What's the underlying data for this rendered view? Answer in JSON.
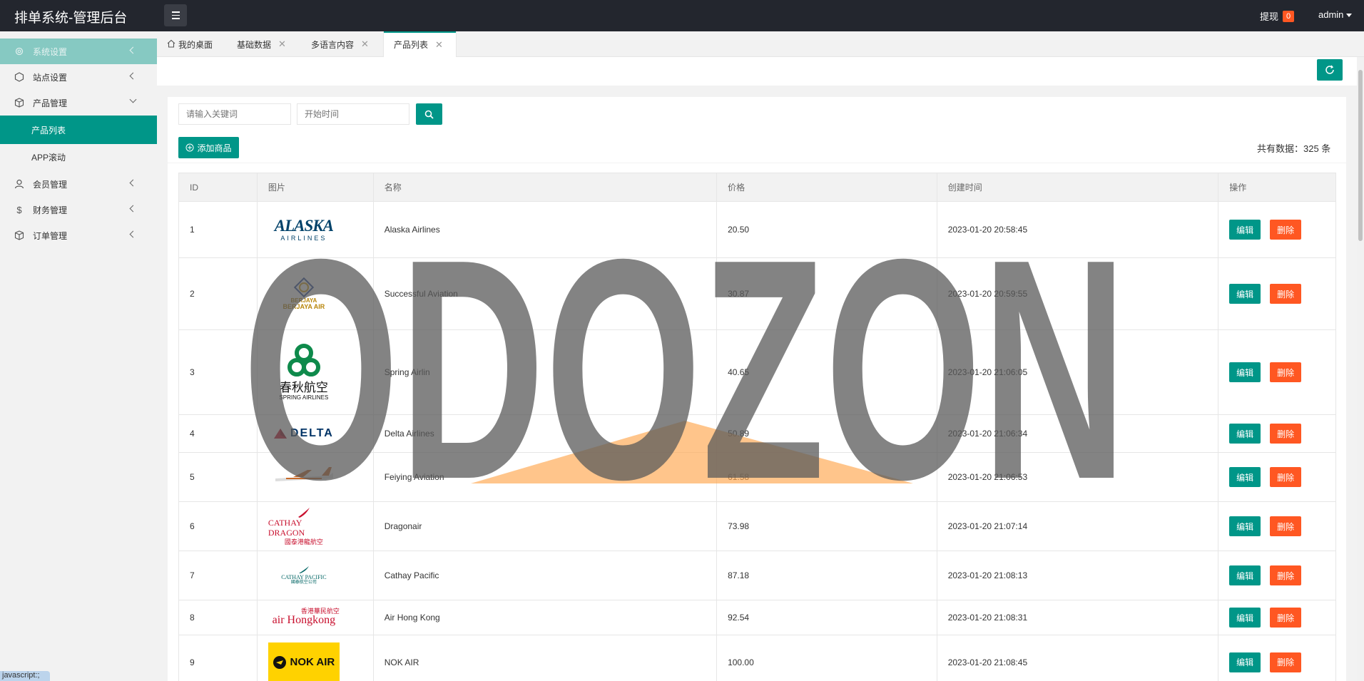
{
  "app": {
    "brand": "排单系统-管理后台",
    "withdraw_label": "提现",
    "withdraw_count": "0",
    "user": "admin"
  },
  "sidebar": {
    "items": [
      {
        "label": "系统设置",
        "icon": "gear-icon"
      },
      {
        "label": "站点设置",
        "icon": "cube-icon"
      },
      {
        "label": "产品管理",
        "icon": "box-icon"
      },
      {
        "label": "产品列表"
      },
      {
        "label": "APP滚动"
      },
      {
        "label": "会员管理",
        "icon": "user-icon"
      },
      {
        "label": "财务管理",
        "icon": "dollar-icon"
      },
      {
        "label": "订单管理",
        "icon": "box-icon"
      }
    ]
  },
  "tabs": [
    {
      "label": "我的桌面"
    },
    {
      "label": "基础数据"
    },
    {
      "label": "多语言内容"
    },
    {
      "label": "产品列表"
    }
  ],
  "search": {
    "keyword_placeholder": "请输入关键词",
    "date_placeholder": "开始时间"
  },
  "add_button": "添加商品",
  "count_text": "共有数据：325 条",
  "table": {
    "headers": [
      "ID",
      "图片",
      "名称",
      "价格",
      "创建时间",
      "操作"
    ],
    "edit_label": "编辑",
    "delete_label": "删除",
    "rows": [
      {
        "id": "1",
        "name": "Alaska Airlines",
        "price": "20.50",
        "created": "2023-01-20 20:58:45",
        "logo": "ALASKA",
        "logo_sub": "AIRLINES"
      },
      {
        "id": "2",
        "name": "Successful Aviation",
        "price": "30.87",
        "created": "2023-01-20 20:59:55",
        "logo": "BERJAYA",
        "logo_sub": "BERJAYA AIR"
      },
      {
        "id": "3",
        "name": "Spring Airlin",
        "price": "40.65",
        "created": "2023-01-20 21:06:05",
        "logo": "春秋航空",
        "logo_sub": "SPRING AIRLINES"
      },
      {
        "id": "4",
        "name": "Delta Airlines",
        "price": "50.89",
        "created": "2023-01-20 21:06:34",
        "logo": "DELTA",
        "logo_sub": ""
      },
      {
        "id": "5",
        "name": "Feiying Aviation",
        "price": "61.58",
        "created": "2023-01-20 21:06:53",
        "logo": "",
        "logo_sub": ""
      },
      {
        "id": "6",
        "name": "Dragonair",
        "price": "73.98",
        "created": "2023-01-20 21:07:14",
        "logo": "CATHAY DRAGON",
        "logo_sub": "國泰港龍航空"
      },
      {
        "id": "7",
        "name": "Cathay Pacific",
        "price": "87.18",
        "created": "2023-01-20 21:08:13",
        "logo": "CATHAY PACIFIC",
        "logo_sub": "國泰航空公司"
      },
      {
        "id": "8",
        "name": "Air Hong Kong",
        "price": "92.54",
        "created": "2023-01-20 21:08:31",
        "logo": "air Hongkong",
        "logo_sub": "香港華民航空"
      },
      {
        "id": "9",
        "name": "NOK AIR",
        "price": "100.00",
        "created": "2023-01-20 21:08:45",
        "logo": "NOK AIR",
        "logo_sub": ""
      }
    ]
  },
  "watermark": "ODOZON",
  "status_bar": "javascript:;",
  "colors": {
    "primary": "#009688",
    "danger": "#ff5722",
    "topbar": "#23262e"
  }
}
